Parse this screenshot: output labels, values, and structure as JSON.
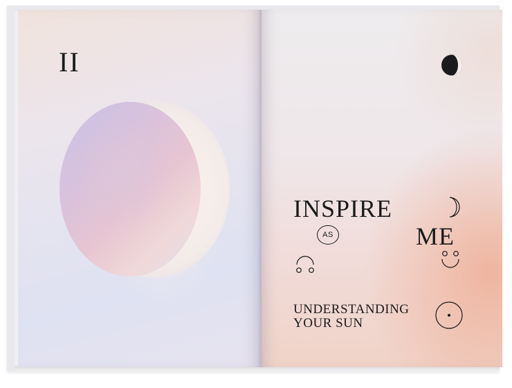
{
  "left_page": {
    "chapter_numeral": "II"
  },
  "right_page": {
    "title_line_1": "INSPIRE",
    "connector": "AS",
    "title_line_2": "ME",
    "subtitle_line_1": "UNDERSTANDING",
    "subtitle_line_2": "YOUR SUN"
  },
  "icons": {
    "corner_moon": "dark-moon-icon",
    "crescent": "crescent-moon-icon",
    "taurus_left": "taurus-symbol-icon",
    "taurus_right": "taurus-symbol-icon",
    "sun": "sun-symbol-icon"
  },
  "colors": {
    "ink": "#1b1b1d",
    "left_page_tint": "#e4e3f0",
    "right_page_accent": "#eea88c"
  }
}
